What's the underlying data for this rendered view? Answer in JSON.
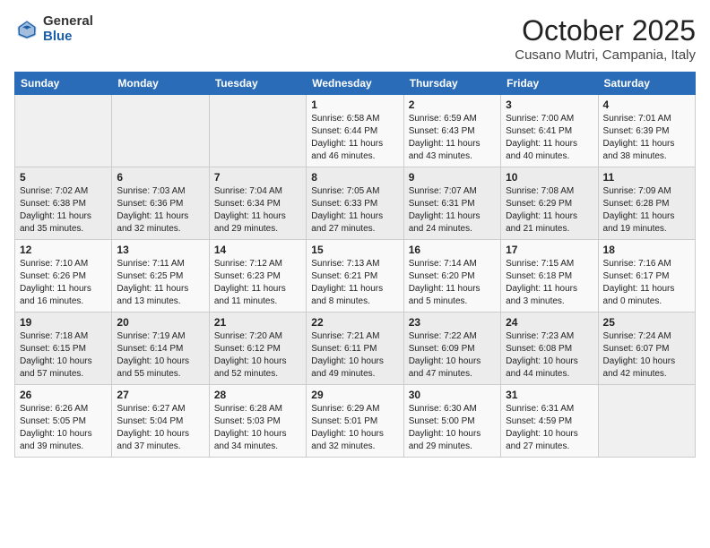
{
  "header": {
    "logo_general": "General",
    "logo_blue": "Blue",
    "month_title": "October 2025",
    "location": "Cusano Mutri, Campania, Italy"
  },
  "columns": [
    "Sunday",
    "Monday",
    "Tuesday",
    "Wednesday",
    "Thursday",
    "Friday",
    "Saturday"
  ],
  "weeks": [
    [
      {
        "day": "",
        "info": ""
      },
      {
        "day": "",
        "info": ""
      },
      {
        "day": "",
        "info": ""
      },
      {
        "day": "1",
        "info": "Sunrise: 6:58 AM\nSunset: 6:44 PM\nDaylight: 11 hours\nand 46 minutes."
      },
      {
        "day": "2",
        "info": "Sunrise: 6:59 AM\nSunset: 6:43 PM\nDaylight: 11 hours\nand 43 minutes."
      },
      {
        "day": "3",
        "info": "Sunrise: 7:00 AM\nSunset: 6:41 PM\nDaylight: 11 hours\nand 40 minutes."
      },
      {
        "day": "4",
        "info": "Sunrise: 7:01 AM\nSunset: 6:39 PM\nDaylight: 11 hours\nand 38 minutes."
      }
    ],
    [
      {
        "day": "5",
        "info": "Sunrise: 7:02 AM\nSunset: 6:38 PM\nDaylight: 11 hours\nand 35 minutes."
      },
      {
        "day": "6",
        "info": "Sunrise: 7:03 AM\nSunset: 6:36 PM\nDaylight: 11 hours\nand 32 minutes."
      },
      {
        "day": "7",
        "info": "Sunrise: 7:04 AM\nSunset: 6:34 PM\nDaylight: 11 hours\nand 29 minutes."
      },
      {
        "day": "8",
        "info": "Sunrise: 7:05 AM\nSunset: 6:33 PM\nDaylight: 11 hours\nand 27 minutes."
      },
      {
        "day": "9",
        "info": "Sunrise: 7:07 AM\nSunset: 6:31 PM\nDaylight: 11 hours\nand 24 minutes."
      },
      {
        "day": "10",
        "info": "Sunrise: 7:08 AM\nSunset: 6:29 PM\nDaylight: 11 hours\nand 21 minutes."
      },
      {
        "day": "11",
        "info": "Sunrise: 7:09 AM\nSunset: 6:28 PM\nDaylight: 11 hours\nand 19 minutes."
      }
    ],
    [
      {
        "day": "12",
        "info": "Sunrise: 7:10 AM\nSunset: 6:26 PM\nDaylight: 11 hours\nand 16 minutes."
      },
      {
        "day": "13",
        "info": "Sunrise: 7:11 AM\nSunset: 6:25 PM\nDaylight: 11 hours\nand 13 minutes."
      },
      {
        "day": "14",
        "info": "Sunrise: 7:12 AM\nSunset: 6:23 PM\nDaylight: 11 hours\nand 11 minutes."
      },
      {
        "day": "15",
        "info": "Sunrise: 7:13 AM\nSunset: 6:21 PM\nDaylight: 11 hours\nand 8 minutes."
      },
      {
        "day": "16",
        "info": "Sunrise: 7:14 AM\nSunset: 6:20 PM\nDaylight: 11 hours\nand 5 minutes."
      },
      {
        "day": "17",
        "info": "Sunrise: 7:15 AM\nSunset: 6:18 PM\nDaylight: 11 hours\nand 3 minutes."
      },
      {
        "day": "18",
        "info": "Sunrise: 7:16 AM\nSunset: 6:17 PM\nDaylight: 11 hours\nand 0 minutes."
      }
    ],
    [
      {
        "day": "19",
        "info": "Sunrise: 7:18 AM\nSunset: 6:15 PM\nDaylight: 10 hours\nand 57 minutes."
      },
      {
        "day": "20",
        "info": "Sunrise: 7:19 AM\nSunset: 6:14 PM\nDaylight: 10 hours\nand 55 minutes."
      },
      {
        "day": "21",
        "info": "Sunrise: 7:20 AM\nSunset: 6:12 PM\nDaylight: 10 hours\nand 52 minutes."
      },
      {
        "day": "22",
        "info": "Sunrise: 7:21 AM\nSunset: 6:11 PM\nDaylight: 10 hours\nand 49 minutes."
      },
      {
        "day": "23",
        "info": "Sunrise: 7:22 AM\nSunset: 6:09 PM\nDaylight: 10 hours\nand 47 minutes."
      },
      {
        "day": "24",
        "info": "Sunrise: 7:23 AM\nSunset: 6:08 PM\nDaylight: 10 hours\nand 44 minutes."
      },
      {
        "day": "25",
        "info": "Sunrise: 7:24 AM\nSunset: 6:07 PM\nDaylight: 10 hours\nand 42 minutes."
      }
    ],
    [
      {
        "day": "26",
        "info": "Sunrise: 6:26 AM\nSunset: 5:05 PM\nDaylight: 10 hours\nand 39 minutes."
      },
      {
        "day": "27",
        "info": "Sunrise: 6:27 AM\nSunset: 5:04 PM\nDaylight: 10 hours\nand 37 minutes."
      },
      {
        "day": "28",
        "info": "Sunrise: 6:28 AM\nSunset: 5:03 PM\nDaylight: 10 hours\nand 34 minutes."
      },
      {
        "day": "29",
        "info": "Sunrise: 6:29 AM\nSunset: 5:01 PM\nDaylight: 10 hours\nand 32 minutes."
      },
      {
        "day": "30",
        "info": "Sunrise: 6:30 AM\nSunset: 5:00 PM\nDaylight: 10 hours\nand 29 minutes."
      },
      {
        "day": "31",
        "info": "Sunrise: 6:31 AM\nSunset: 4:59 PM\nDaylight: 10 hours\nand 27 minutes."
      },
      {
        "day": "",
        "info": ""
      }
    ]
  ]
}
